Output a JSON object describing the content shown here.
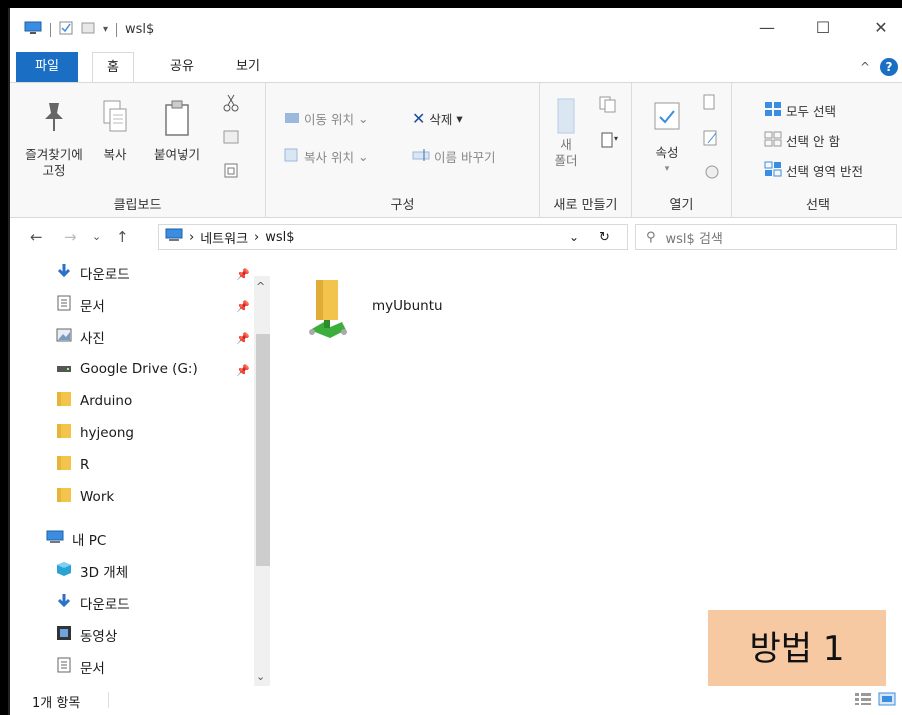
{
  "window": {
    "title": "wsl$"
  },
  "tabs": {
    "file": "파일",
    "home": "홈",
    "share": "공유",
    "view": "보기"
  },
  "ribbon": {
    "clipboard": {
      "pin": "즐겨찾기에\n고정",
      "copy": "복사",
      "paste": "붙여넣기",
      "label": "클립보드"
    },
    "organize": {
      "move_to": "이동 위치",
      "copy_to": "복사 위치",
      "delete": "삭제",
      "rename": "이름 바꾸기",
      "label": "구성"
    },
    "new": {
      "new_folder": "새\n폴더",
      "label": "새로 만들기"
    },
    "open": {
      "properties": "속성",
      "label": "열기"
    },
    "select": {
      "select_all": "모두 선택",
      "select_none": "선택 안 함",
      "invert": "선택 영역 반전",
      "label": "선택"
    }
  },
  "address": {
    "path": [
      "네트워크",
      "wsl$"
    ]
  },
  "search": {
    "placeholder": "wsl$ 검색"
  },
  "sidebar": {
    "items": [
      {
        "label": "다운로드",
        "icon": "download-icon",
        "pinned": true
      },
      {
        "label": "문서",
        "icon": "document-icon",
        "pinned": true
      },
      {
        "label": "사진",
        "icon": "picture-icon",
        "pinned": true
      },
      {
        "label": "Google Drive (G:)",
        "icon": "drive-icon",
        "pinned": true
      },
      {
        "label": "Arduino",
        "icon": "folder-icon",
        "pinned": false
      },
      {
        "label": "hyjeong",
        "icon": "folder-icon",
        "pinned": false
      },
      {
        "label": "R",
        "icon": "folder-icon",
        "pinned": false
      },
      {
        "label": "Work",
        "icon": "folder-icon",
        "pinned": false
      },
      {
        "label": "내 PC",
        "icon": "pc-icon",
        "pinned": false
      },
      {
        "label": "3D 개체",
        "icon": "cube-icon",
        "pinned": false
      },
      {
        "label": "다운로드",
        "icon": "download-icon",
        "pinned": false
      },
      {
        "label": "동영상",
        "icon": "video-icon",
        "pinned": false
      },
      {
        "label": "문서",
        "icon": "document-icon",
        "pinned": false
      }
    ]
  },
  "content": {
    "items": [
      {
        "name": "myUbuntu",
        "icon": "network-folder-icon"
      }
    ]
  },
  "overlay": {
    "text": "방법 1"
  },
  "status": {
    "count": "1개 항목"
  },
  "colors": {
    "accent": "#1a6fc4",
    "folder": "#f3c44c",
    "overlay": "#f6c9a3"
  }
}
